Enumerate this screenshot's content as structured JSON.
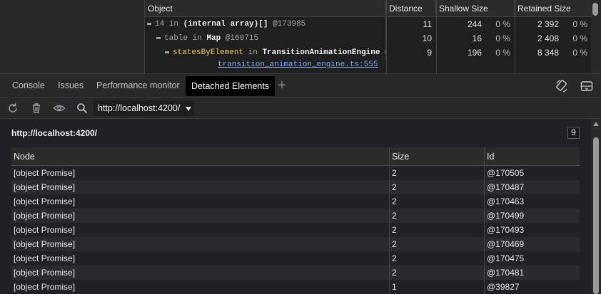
{
  "retainers": {
    "columns": {
      "object": "Object",
      "distance": "Distance",
      "shallow": "Shallow Size",
      "retained": "Retained Size"
    },
    "rows": [
      {
        "prefix": "14",
        "in": "in",
        "name": "(internal array)[]",
        "id": "@173985",
        "distance": "11",
        "shallow": "244",
        "shallow_pct": "0 %",
        "retained": "2 392",
        "retained_pct": "0 %"
      },
      {
        "prefix": "table",
        "in": "in",
        "name": "Map",
        "id": "@160715",
        "distance": "10",
        "shallow": "16",
        "shallow_pct": "0 %",
        "retained": "2 408",
        "retained_pct": "0 %"
      },
      {
        "prefix": "statesByElement",
        "in": "in",
        "name": "TransitionAnimationEngine",
        "id": "@",
        "distance": "9",
        "shallow": "196",
        "shallow_pct": "0 %",
        "retained": "8 348",
        "retained_pct": "0 %"
      }
    ],
    "source_link": "transition_animation_engine.ts:555"
  },
  "drawer": {
    "tabs": [
      "Console",
      "Issues",
      "Performance monitor",
      "Detached Elements"
    ],
    "active_tab": "Detached Elements",
    "add_tab_label": "+"
  },
  "toolbar": {
    "target": "http://localhost:4200/",
    "icons": [
      "refresh-icon",
      "trash-icon",
      "eye-icon",
      "search-icon"
    ]
  },
  "detached": {
    "section_title": "http://localhost:4200/",
    "count": "9",
    "columns": {
      "node": "Node",
      "size": "Size",
      "id": "Id"
    },
    "rows": [
      {
        "node": "[object Promise]",
        "size": "2",
        "id": "@170505"
      },
      {
        "node": "[object Promise]",
        "size": "2",
        "id": "@170487"
      },
      {
        "node": "[object Promise]",
        "size": "2",
        "id": "@170463"
      },
      {
        "node": "[object Promise]",
        "size": "2",
        "id": "@170499"
      },
      {
        "node": "[object Promise]",
        "size": "2",
        "id": "@170493"
      },
      {
        "node": "[object Promise]",
        "size": "2",
        "id": "@170469"
      },
      {
        "node": "[object Promise]",
        "size": "2",
        "id": "@170475"
      },
      {
        "node": "[object Promise]",
        "size": "2",
        "id": "@170481"
      },
      {
        "node": "[object Promise]",
        "size": "1",
        "id": "@39827"
      }
    ]
  },
  "colors": {
    "background": "#202124",
    "panel": "#282828",
    "link": "#7cacf8",
    "active_tab": "#000000"
  }
}
